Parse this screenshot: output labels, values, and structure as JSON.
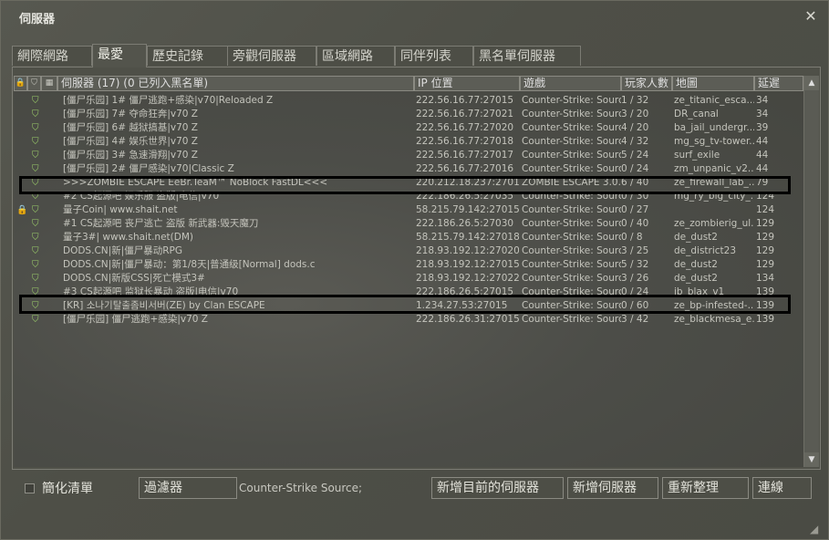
{
  "window": {
    "title": "伺服器"
  },
  "tabs": [
    {
      "label": "網際網路",
      "active": false
    },
    {
      "label": "最愛",
      "active": true
    },
    {
      "label": "歷史記錄",
      "active": false
    },
    {
      "label": "旁觀伺服器",
      "active": false
    },
    {
      "label": "區域網路",
      "active": false
    },
    {
      "label": "同伴列表",
      "active": false
    },
    {
      "label": "黑名單伺服器",
      "active": false
    }
  ],
  "columns": {
    "lock_icon": "lock-icon",
    "vac_icon": "shield-icon",
    "players_icon": "bots-icon",
    "name": "伺服器 (17) (0 已列入黑名單)",
    "ip": "IP 位置",
    "game": "遊戲",
    "players": "玩家人數",
    "map": "地圖",
    "latency": "延遲"
  },
  "servers": [
    {
      "locked": false,
      "vac": true,
      "name": "[僵尸乐园] 1# 僵尸逃跑+感染|v70|Reloaded Z",
      "ip": "222.56.16.77:27015",
      "game": "Counter-Strike: Source",
      "players": "1 / 32",
      "map": "ze_titanic_esca...",
      "latency": "34"
    },
    {
      "locked": false,
      "vac": true,
      "name": "[僵尸乐园] 7# 夺命狂奔|v70 Z",
      "ip": "222.56.16.77:27021",
      "game": "Counter-Strike: Source",
      "players": "3 / 20",
      "map": "DR_canal",
      "latency": "34"
    },
    {
      "locked": false,
      "vac": true,
      "name": "[僵尸乐园] 6# 越狱搞基|v70 Z",
      "ip": "222.56.16.77:27020",
      "game": "Counter-Strike: Source",
      "players": "4 / 20",
      "map": "ba_jail_undergr...",
      "latency": "39"
    },
    {
      "locked": false,
      "vac": true,
      "name": "[僵尸乐园] 4# 娱乐世界|v70 Z",
      "ip": "222.56.16.77:27018",
      "game": "Counter-Strike: Source",
      "players": "4 / 32",
      "map": "mg_sg_tv-tower...",
      "latency": "44"
    },
    {
      "locked": false,
      "vac": true,
      "name": "[僵尸乐园] 3# 急速滑翔|v70 Z",
      "ip": "222.56.16.77:27017",
      "game": "Counter-Strike: Source",
      "players": "5 / 24",
      "map": "surf_exile",
      "latency": "44"
    },
    {
      "locked": false,
      "vac": true,
      "name": "[僵尸乐园] 2# 僵尸感染|v70|Classic Z",
      "ip": "222.56.16.77:27016",
      "game": "Counter-Strike: Source",
      "players": "0 / 24",
      "map": "zm_unpanic_v2...",
      "latency": "44"
    },
    {
      "locked": false,
      "vac": true,
      "name": ">>>ZOMBIE ESCAPE EeBr.TeaM™ NoBlock FastDL<<<",
      "ip": "220.212.18.237:27015",
      "game": "ZOMBIE ESCAPE 3.0...",
      "players": "6 / 40",
      "map": "ze_firewall_lab_...",
      "latency": "79"
    },
    {
      "locked": false,
      "vac": true,
      "name": "#2 CS起源吧 娱乐服 盗版|电信|v70",
      "ip": "222.186.26.5:27035",
      "game": "Counter-Strike: Source",
      "players": "0 / 30",
      "map": "mg_ry_big_city_...",
      "latency": "124"
    },
    {
      "locked": true,
      "vac": true,
      "name": "量子Coin| www.shait.net",
      "ip": "58.215.79.142:27015",
      "game": "Counter-Strike: Source",
      "players": "0 / 27",
      "map": "",
      "latency": "124"
    },
    {
      "locked": false,
      "vac": true,
      "name": "#1 CS起源吧 丧尸逃亡 盗版 新武器:毁天魔刀",
      "ip": "222.186.26.5:27030",
      "game": "Counter-Strike: Source",
      "players": "0 / 40",
      "map": "ze_zombierig_ul...",
      "latency": "129"
    },
    {
      "locked": false,
      "vac": true,
      "name": "量子3#| www.shait.net(DM)",
      "ip": "58.215.79.142:27018",
      "game": "Counter-Strike: Source",
      "players": "0 / 8",
      "map": "de_dust2",
      "latency": "129"
    },
    {
      "locked": false,
      "vac": true,
      "name": "DODS.CN|新|僵尸暴动RPG",
      "ip": "218.93.192.12:27020",
      "game": "Counter-Strike: Source",
      "players": "3 / 25",
      "map": "de_district23",
      "latency": "129"
    },
    {
      "locked": false,
      "vac": true,
      "name": "DODS.CN|新|僵尸暴动：第1/8天|普通级[Normal]   dods.c",
      "ip": "218.93.192.12:27015",
      "game": "Counter-Strike: Source",
      "players": "5 / 32",
      "map": "de_dust2",
      "latency": "129"
    },
    {
      "locked": false,
      "vac": true,
      "name": "DODS.CN|新版CSS|死亡模式3#",
      "ip": "218.93.192.12:27022",
      "game": "Counter-Strike: Source",
      "players": "3 / 26",
      "map": "de_dust2",
      "latency": "134"
    },
    {
      "locked": false,
      "vac": true,
      "name": "#3 CS起源吧 监狱长暴动 盗版|电信|v70",
      "ip": "222.186.26.5:27015",
      "game": "Counter-Strike: Source",
      "players": "0 / 24",
      "map": "jb_blax_v1",
      "latency": "139"
    },
    {
      "locked": false,
      "vac": true,
      "name": "[KR] 소나기탈출좀비서버(ZE) by Clan ESCAPE",
      "ip": "1.234.27.53:27015",
      "game": "Counter-Strike: Source",
      "players": "0 / 60",
      "map": "ze_bp-infested-...",
      "latency": "139"
    },
    {
      "locked": false,
      "vac": true,
      "name": "[僵尸乐园] 僵尸逃跑+感染|v70 Z",
      "ip": "222.186.26.31:27015",
      "game": "Counter-Strike: Source",
      "players": "3 / 42",
      "map": "ze_blackmesa_e...",
      "latency": "139"
    }
  ],
  "bottom": {
    "simplify_label": "簡化清單",
    "filter_button": "過濾器",
    "game_filter_text": "Counter-Strike Source;",
    "add_current_button": "新增目前的伺服器",
    "add_server_button": "新增伺服器",
    "refresh_button": "重新整理",
    "connect_button": "連線"
  },
  "colors": {
    "highlight_border": "#000000",
    "lock": "#c8a838",
    "vac": "#9ccf6a"
  },
  "scrollbar": {
    "up_icon": "scroll-up-arrow-icon",
    "down_icon": "scroll-down-arrow-icon"
  }
}
